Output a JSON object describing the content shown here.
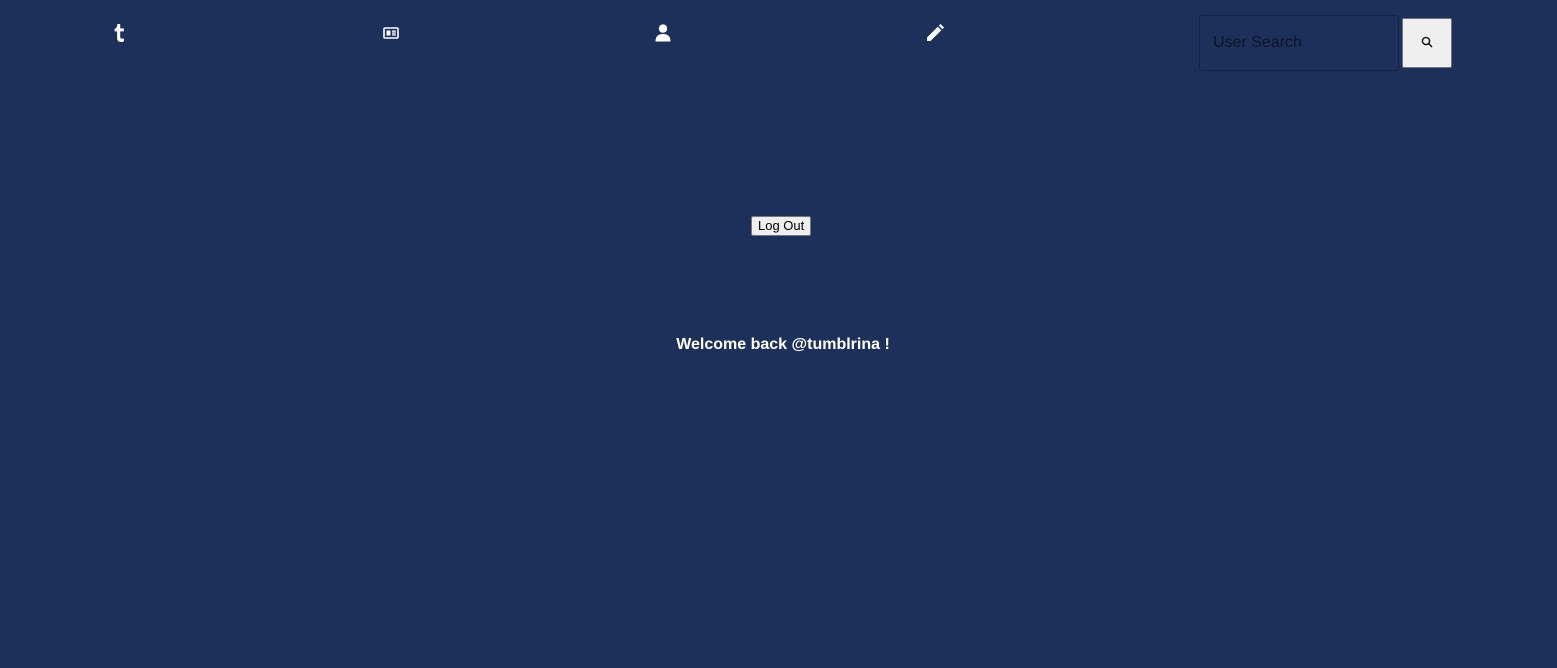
{
  "nav": {
    "items": [
      {
        "name": "home",
        "icon": "tumblr-icon"
      },
      {
        "name": "dashboard",
        "icon": "newspaper-icon"
      },
      {
        "name": "profile",
        "icon": "user-icon"
      },
      {
        "name": "compose",
        "icon": "pencil-icon"
      }
    ]
  },
  "search": {
    "placeholder": "User Search",
    "value": "",
    "button_icon": "search-icon"
  },
  "account": {
    "logout_label": "Log Out"
  },
  "main": {
    "welcome_text": "Welcome back @tumblrina !"
  },
  "colors": {
    "background": "#1d305c",
    "text": "#ffffff",
    "button_bg": "#efefef"
  }
}
